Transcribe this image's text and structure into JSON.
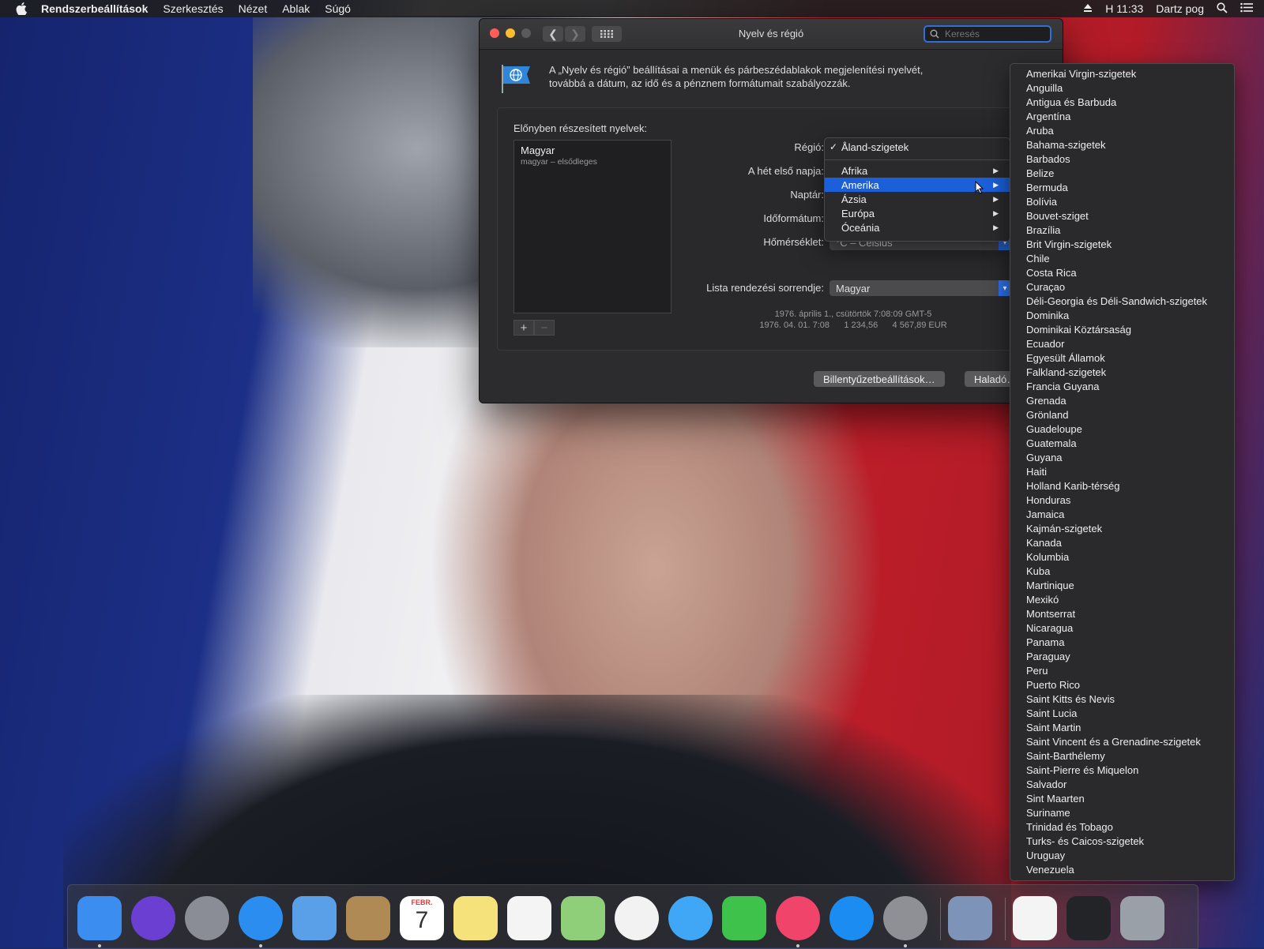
{
  "menubar": {
    "app_name": "Rendszerbeállítások",
    "items": [
      "Szerkesztés",
      "Nézet",
      "Ablak",
      "Súgó"
    ],
    "time": "H 11:33",
    "user": "Dartz pog"
  },
  "window": {
    "title": "Nyelv és régió",
    "search_placeholder": "Keresés",
    "description_line1": "A „Nyelv és régió” beállításai a menük és párbeszédablakok megjelenítési nyelvét,",
    "description_line2": "továbbá a dátum, az idő és a pénznem formátumait szabályozzák.",
    "preferred_languages_label": "Előnyben részesített nyelvek:",
    "language_name": "Magyar",
    "language_sub": "magyar – elsődleges",
    "add_label": "+",
    "remove_label": "−",
    "labels": {
      "region": "Régió:",
      "first_day": "A hét első napja:",
      "calendar": "Naptár:",
      "time_format": "Időformátum:",
      "temperature": "Hőmérséklet:",
      "sort_order": "Lista rendezési sorrendje:"
    },
    "temperature_value": "°C – Celsius",
    "sort_order_value": "Magyar",
    "sample_line1": "1976. április 1., csütörtök 7:08:09 GMT-5",
    "sample_line2": "1976. 04. 01. 7:08      1 234,56      4 567,89 EUR",
    "keyboard_button": "Billentyűzetbeállítások…",
    "advanced_button": "Haladó…"
  },
  "region_menu": {
    "checked_item": "Åland-szigetek",
    "items": [
      "Afrika",
      "Amerika",
      "Ázsia",
      "Európa",
      "Óceánia"
    ],
    "selected": "Amerika"
  },
  "country_menu": {
    "items": [
      "Amerikai Virgin-szigetek",
      "Anguilla",
      "Antigua és Barbuda",
      "Argentína",
      "Aruba",
      "Bahama-szigetek",
      "Barbados",
      "Belize",
      "Bermuda",
      "Bolívia",
      "Bouvet-sziget",
      "Brazília",
      "Brit Virgin-szigetek",
      "Chile",
      "Costa Rica",
      "Curaçao",
      "Déli-Georgia és Déli-Sandwich-szigetek",
      "Dominika",
      "Dominikai Köztársaság",
      "Ecuador",
      "Egyesült Államok",
      "Falkland-szigetek",
      "Francia Guyana",
      "Grenada",
      "Grönland",
      "Guadeloupe",
      "Guatemala",
      "Guyana",
      "Haiti",
      "Holland Karib-térség",
      "Honduras",
      "Jamaica",
      "Kajmán-szigetek",
      "Kanada",
      "Kolumbia",
      "Kuba",
      "Martinique",
      "Mexikó",
      "Montserrat",
      "Nicaragua",
      "Panama",
      "Paraguay",
      "Peru",
      "Puerto Rico",
      "Saint Kitts és Nevis",
      "Saint Lucia",
      "Saint Martin",
      "Saint Vincent és a Grenadine-szigetek",
      "Saint-Barthélemy",
      "Saint-Pierre és Miquelon",
      "Salvador",
      "Sint Maarten",
      "Suriname",
      "Trinidad és Tobago",
      "Turks- és Caicos-szigetek",
      "Uruguay",
      "Venezuela"
    ]
  },
  "dock": {
    "calendar_month": "FEBR.",
    "calendar_day": "7",
    "icons": [
      {
        "name": "finder-icon",
        "color": "#3b8ef0"
      },
      {
        "name": "siri-icon",
        "color": "#6b3fd1"
      },
      {
        "name": "launchpad-icon",
        "color": "#8a8d96"
      },
      {
        "name": "safari-icon",
        "color": "#2c8df0"
      },
      {
        "name": "mail-icon",
        "color": "#5aa0e8"
      },
      {
        "name": "contacts-icon",
        "color": "#b08a55"
      },
      {
        "name": "calendar-icon",
        "color": "#ffffff"
      },
      {
        "name": "notes-icon",
        "color": "#f6e27a"
      },
      {
        "name": "reminders-icon",
        "color": "#f4f4f4"
      },
      {
        "name": "maps-icon",
        "color": "#8fcf7a"
      },
      {
        "name": "photos-icon",
        "color": "#f2f2f2"
      },
      {
        "name": "messages-icon",
        "color": "#3fa7f5"
      },
      {
        "name": "facetime-icon",
        "color": "#3ec24b"
      },
      {
        "name": "music-icon",
        "color": "#f0446a"
      },
      {
        "name": "app-store-icon",
        "color": "#1b8cf1"
      },
      {
        "name": "system-preferences-icon",
        "color": "#8e9096"
      },
      {
        "name": "preview-icon",
        "color": "#7d93b8"
      },
      {
        "name": "document-icon",
        "color": "#f4f4f4"
      },
      {
        "name": "safari-minimized-icon",
        "color": "#222428"
      },
      {
        "name": "trash-icon",
        "color": "#9aa0a8"
      }
    ]
  }
}
